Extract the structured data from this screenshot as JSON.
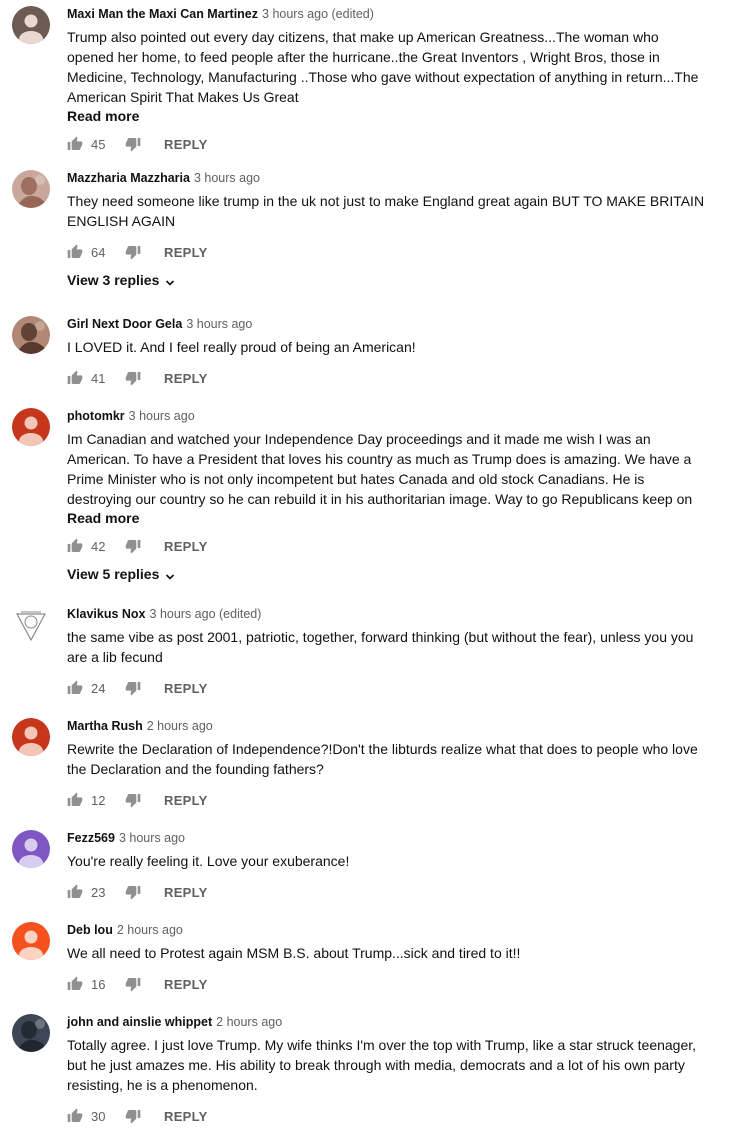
{
  "comments": [
    {
      "author": "Maxi Man the Maxi Can Martinez",
      "time": "3 hours ago (edited)",
      "lines": [
        "Trump also pointed out every day citizens, that make up American Greatness...The woman who",
        "opened her home, to feed people after the hurricane..the Great Inventors , Wright Bros, those in",
        "Medicine, Technology, Manufacturing ..Those who gave without expectation of anything in return...The",
        "American Spirit That Makes Us Great"
      ],
      "read_more": "Read more",
      "likes": "45",
      "reply": "REPLY",
      "avatar": "person-icon",
      "avatar_bg": "#6b5b52",
      "avatar_fg": "#ead8d0"
    },
    {
      "author": "Mazzharia Mazzharia",
      "time": "3 hours ago",
      "lines": [
        "They need someone like trump in the uk not just to make England great again BUT TO MAKE BRITAIN",
        "ENGLISH AGAIN"
      ],
      "likes": "64",
      "reply": "REPLY",
      "view_replies": "View 3 replies",
      "avatar": "photo-avatar",
      "avatar_bg": "#c9a89b",
      "avatar_fg": "#8d5c4b"
    },
    {
      "author": "Girl Next Door Gela",
      "time": "3 hours ago",
      "lines": [
        "I LOVED it. And I feel really proud of  being an American!"
      ],
      "likes": "41",
      "reply": "REPLY",
      "avatar": "photo-avatar",
      "avatar_bg": "#b08875",
      "avatar_fg": "#4a2b22"
    },
    {
      "author": "photomkr",
      "time": "3 hours ago",
      "lines": [
        "Im Canadian and watched your Independence Day proceedings and it made me wish I was an",
        "American. To have a President that loves his country as much as Trump does is amazing. We have a",
        "Prime Minister who is not only incompetent but hates Canada and old stock Canadians. He is",
        "destroying our country so he can rebuild it in his authoritarian image. Way to go Republicans keep on"
      ],
      "read_more": "Read more",
      "likes": "42",
      "reply": "REPLY",
      "view_replies": "View 5 replies",
      "avatar": "person-icon",
      "avatar_bg": "#c6361b",
      "avatar_fg": "#f4c6b8"
    },
    {
      "author": "Klavikus Nox",
      "time": "3 hours ago (edited)",
      "lines": [
        "the same vibe as post 2001, patriotic, together, forward thinking (but without the fear), unless you you",
        "are a lib fecund"
      ],
      "likes": "24",
      "reply": "REPLY",
      "avatar": "emblem-avatar",
      "avatar_bg": "#ffffff",
      "avatar_fg": "#8a8a8a"
    },
    {
      "author": "Martha Rush",
      "time": "2 hours ago",
      "lines": [
        "Rewrite the Declaration of Independence?!Don't the libturds realize what that does to people who love",
        "the Declaration and the founding fathers?"
      ],
      "likes": "12",
      "reply": "REPLY",
      "avatar": "person-icon",
      "avatar_bg": "#c6361b",
      "avatar_fg": "#f4c6b8"
    },
    {
      "author": "Fezz569",
      "time": "3 hours ago",
      "lines": [
        "You're really feeling it. Love your exuberance!"
      ],
      "likes": "23",
      "reply": "REPLY",
      "avatar": "person-icon",
      "avatar_bg": "#7e57c2",
      "avatar_fg": "#d9ccf0"
    },
    {
      "author": "Deb lou",
      "time": "2 hours ago",
      "lines": [
        "We all need to Protest again MSM B.S. about Trump...sick and tired to it!!"
      ],
      "likes": "16",
      "reply": "REPLY",
      "avatar": "person-icon",
      "avatar_bg": "#f4511e",
      "avatar_fg": "#fcd2c2"
    },
    {
      "author": "john and ainslie whippet",
      "time": "2 hours ago",
      "lines": [
        "Totally agree. I just love Trump. My wife thinks I'm over the top with Trump, like a star struck teenager,",
        "but he just amazes me. His ability to break through with media, democrats and a lot of his own party",
        "resisting, he is a phenomenon."
      ],
      "likes": "30",
      "reply": "REPLY",
      "avatar": "photo-avatar",
      "avatar_bg": "#3c4654",
      "avatar_fg": "#1c2129"
    }
  ]
}
